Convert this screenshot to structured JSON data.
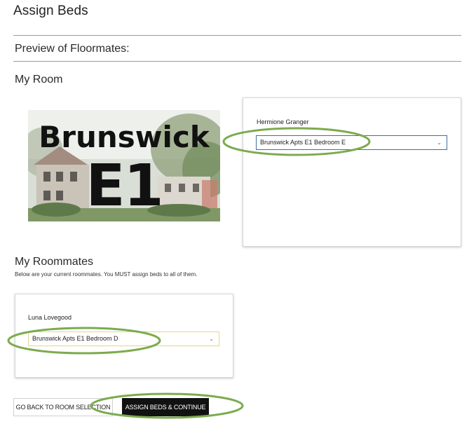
{
  "page": {
    "title": "Assign Beds",
    "preview_heading": "Preview of Floormates:",
    "my_room_heading": "My Room",
    "my_roommates_heading": "My Roommates",
    "roommates_help": "Below are your current roommates. You MUST assign beds to all of them."
  },
  "room_image": {
    "line1": "Brunswick",
    "line2": "E1"
  },
  "my_room_card": {
    "name": "Hermione Granger",
    "selected_bed": "Brunswick Apts E1 Bedroom E"
  },
  "roommates": [
    {
      "name": "Luna Lovegood",
      "selected_bed": "Brunswick Apts E1 Bedroom D"
    }
  ],
  "buttons": {
    "back": "Go Back to Room Selection",
    "assign": "Assign Beds & Continue"
  },
  "colors": {
    "highlight": "#7cab4f",
    "primary_button": "#111111",
    "select_border": "#3c6fa5",
    "roommate_select_border": "#e8d58a"
  },
  "icons": {
    "select_arrow": "chevron-down-icon"
  }
}
